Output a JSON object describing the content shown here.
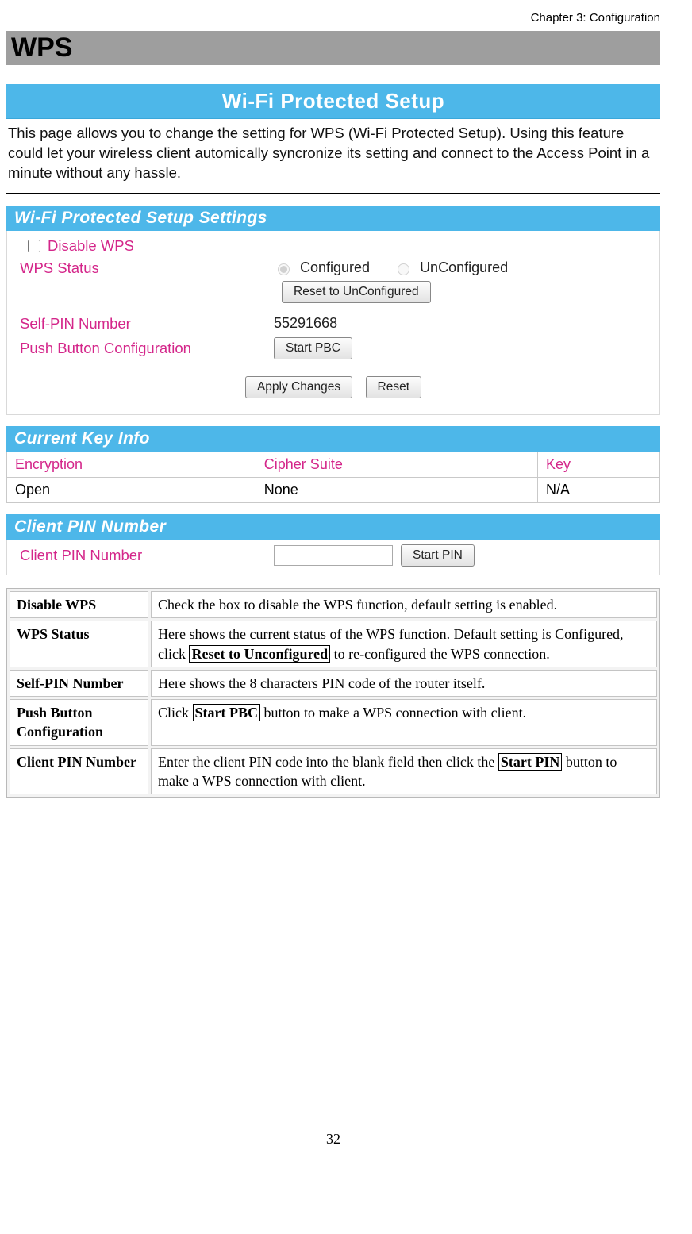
{
  "chapter": "Chapter 3: Configuration",
  "heading": "WPS",
  "screenshot": {
    "banner": "Wi-Fi Protected Setup",
    "intro": "This page allows you to change the setting for WPS (Wi-Fi Protected Setup). Using this feature could let your wireless client automically syncronize its setting and connect to the Access Point in a minute without any hassle.",
    "settings": {
      "header": "Wi-Fi Protected Setup Settings",
      "disable_label": "Disable WPS",
      "status_label": "WPS Status",
      "status_options": {
        "configured": "Configured",
        "unconfigured": "UnConfigured"
      },
      "reset_btn": "Reset to UnConfigured",
      "selfpin_label": "Self-PIN Number",
      "selfpin_value": "55291668",
      "pbc_label": "Push Button Configuration",
      "pbc_btn": "Start PBC",
      "apply_btn": "Apply Changes",
      "resetform_btn": "Reset"
    },
    "keyinfo": {
      "header": "Current Key Info",
      "th1": "Encryption",
      "th2": "Cipher Suite",
      "th3": "Key",
      "td1": "Open",
      "td2": "None",
      "td3": "N/A"
    },
    "clientpin": {
      "header": "Client PIN Number",
      "label": "Client PIN Number",
      "btn": "Start PIN"
    }
  },
  "desc": {
    "r1": {
      "k": "Disable WPS",
      "v": "Check the box to disable the WPS function, default setting is enabled."
    },
    "r2": {
      "k": "WPS Status",
      "v_pre": "Here shows the current status of the WPS function. Default setting is Configured, click ",
      "v_box": "Reset to Unconfigured",
      "v_post": " to re-configured the WPS connection."
    },
    "r3": {
      "k": "Self-PIN Number",
      "v": "Here shows the 8 characters PIN code of the router itself."
    },
    "r4": {
      "k": "Push Button Configuration",
      "v_pre": "Click ",
      "v_box": "Start PBC",
      "v_post": " button to make a WPS connection with client."
    },
    "r5": {
      "k": "Client PIN Number",
      "v_pre": "Enter the client PIN code into the blank field then click the ",
      "v_box": "Start PIN",
      "v_post": " button to make a WPS connection with client."
    }
  },
  "page_number": "32"
}
